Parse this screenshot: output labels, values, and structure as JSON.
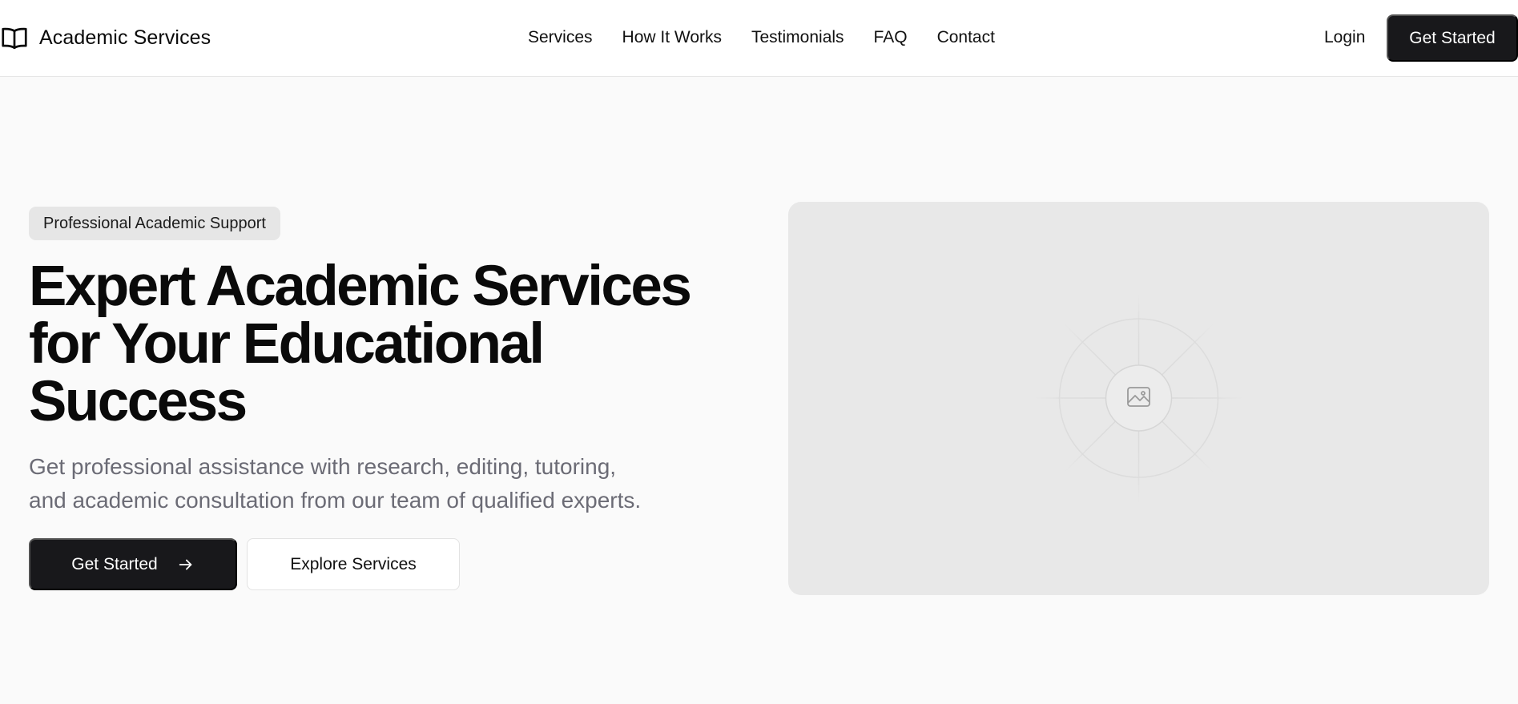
{
  "header": {
    "brand": {
      "name": "Academic Services",
      "icon": "open-book-icon"
    },
    "nav": [
      {
        "label": "Services"
      },
      {
        "label": "How It Works"
      },
      {
        "label": "Testimonials"
      },
      {
        "label": "FAQ"
      },
      {
        "label": "Contact"
      }
    ],
    "login_label": "Login",
    "cta_label": "Get Started"
  },
  "hero": {
    "badge": "Professional Academic Support",
    "headline_lines": [
      "Expert Academic Services",
      "for Your Educational",
      "Success"
    ],
    "subtitle_lines": [
      "Get professional assistance with research, editing, tutoring,",
      "and academic consultation from our team of qualified experts."
    ],
    "primary_button": {
      "label": "Get Started",
      "icon": "arrow-right-icon"
    },
    "secondary_button": {
      "label": "Explore Services"
    },
    "image": {
      "icon": "image-placeholder-icon"
    }
  },
  "colors": {
    "background": "#fafafa",
    "header_background": "#ffffff",
    "primary_button": "#18181b",
    "badge_background": "#e6e6e6",
    "subtitle_text": "#6b6b75",
    "image_placeholder": "#e8e8e8"
  }
}
